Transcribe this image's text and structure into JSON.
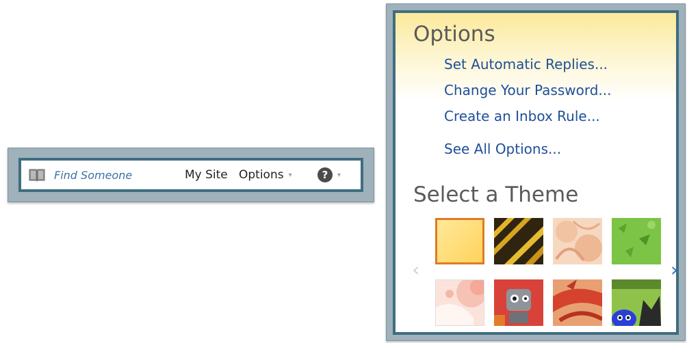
{
  "toolbar": {
    "find_someone": "Find Someone",
    "my_site": "My Site",
    "options": "Options",
    "options_caret": "▾",
    "help": "?",
    "help_caret": "▾"
  },
  "panel": {
    "title": "Options",
    "links": [
      "Set Automatic Replies...",
      "Change Your Password...",
      "Create an Inbox Rule...",
      "See All Options..."
    ],
    "theme_title": "Select a Theme",
    "prev_arrow": "‹",
    "next_arrow": "›",
    "themes": [
      {
        "name": "theme-yellow",
        "selected": true
      },
      {
        "name": "theme-black-yellow",
        "selected": false
      },
      {
        "name": "theme-peach-pattern",
        "selected": false
      },
      {
        "name": "theme-green",
        "selected": false
      },
      {
        "name": "theme-pink-circles",
        "selected": false
      },
      {
        "name": "theme-robot",
        "selected": false
      },
      {
        "name": "theme-red-dragon",
        "selected": false
      },
      {
        "name": "theme-cat",
        "selected": false
      }
    ]
  },
  "colors": {
    "frame": "#9fb1bb",
    "border": "#3f6d80",
    "link": "#1f4e99",
    "accent_selected": "#e07a24"
  }
}
